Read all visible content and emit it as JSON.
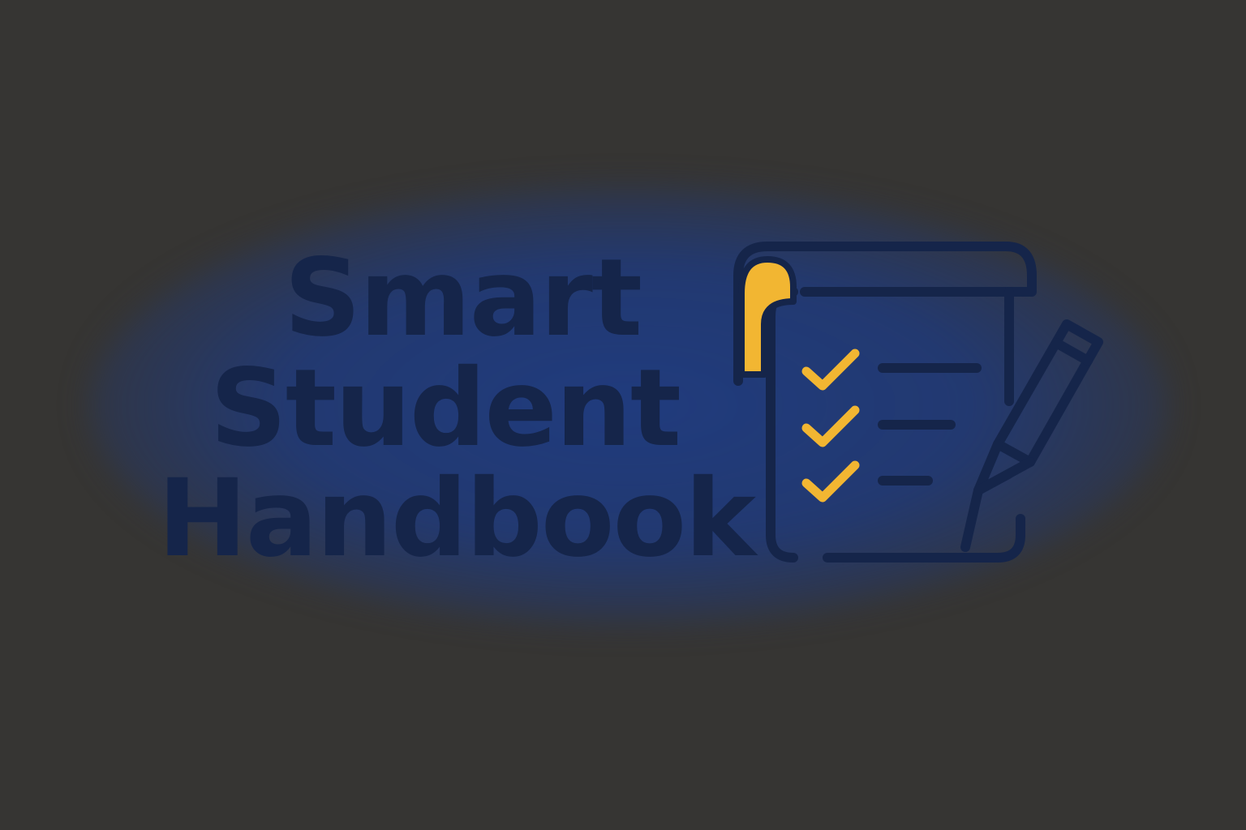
{
  "title": {
    "line1": "Smart",
    "line2": "Student",
    "line3": "Handbook"
  },
  "colors": {
    "background": "#363533",
    "glow": "#1f3c82",
    "ink": "#15254a",
    "accent": "#f2b632"
  },
  "icons": {
    "logo": "checklist-notepad-icon",
    "pencil": "pencil-icon",
    "checks": [
      "check-icon",
      "check-icon",
      "check-icon"
    ]
  }
}
